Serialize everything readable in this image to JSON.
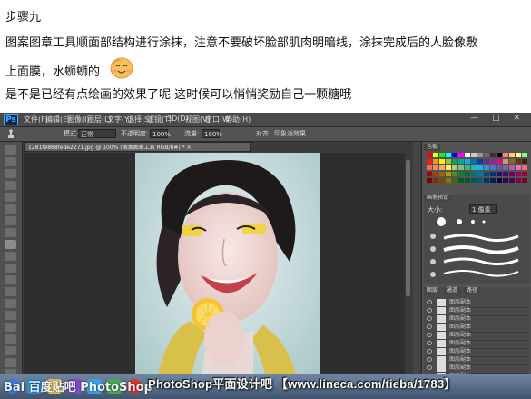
{
  "tutorial": {
    "step_title": "步骤九",
    "line1": "图案图章工具顺面部结构进行涂抹，注意不要破坏脸部肌肉明暗线，涂抹完成后的人脸像敷",
    "line2": "上面膜，水蛳蛳的",
    "line3": "是不是已经有点绘画的效果了呢 这时候可以悄悄奖励自己一颗糖哦",
    "emoji": "smile-emoji"
  },
  "photoshop": {
    "logo": "Ps",
    "menu": [
      "文件(F)",
      "编辑(E)",
      "图像(I)",
      "图层(L)",
      "文字(Y)",
      "选择(S)",
      "滤镜(T)",
      "3D(D)",
      "视图(V)",
      "窗口(W)",
      "帮助(H)"
    ],
    "window_controls": "— □ ✕",
    "options": {
      "mode_label": "模式:",
      "mode_value": "正常",
      "opacity_label": "不透明度:",
      "opacity_value": "100%",
      "flow_label": "流量:",
      "flow_value": "100%",
      "aligned": "对齐",
      "impressionist": "印象派效果"
    },
    "document_tab": "1281f9868fede2271.jpg @ 100% (图案图章工具 RGB/8#) * ×",
    "panels": {
      "swatch_tab": "色板",
      "brush_tab": "画笔预设",
      "size_label": "大小:",
      "size_value": "1 像素",
      "layers_tab": "图层",
      "channels_tab": "通道",
      "paths_tab": "路径"
    },
    "layers": [
      "图层副本",
      "图层副本",
      "图层副本",
      "图层副本",
      "图层副本",
      "图层副本",
      "图层副本",
      "图层副本",
      "图层副本",
      "图层副本",
      "图层副本",
      "图层副本"
    ],
    "colors": {
      "foreground": "#e87a8a",
      "background": "#ffffff"
    }
  },
  "watermark": {
    "left": "Bai 百度贴吧 PhotoShop",
    "right": "PhotoShop平面设计吧 【www.lineca.com/tieba/1783】"
  }
}
